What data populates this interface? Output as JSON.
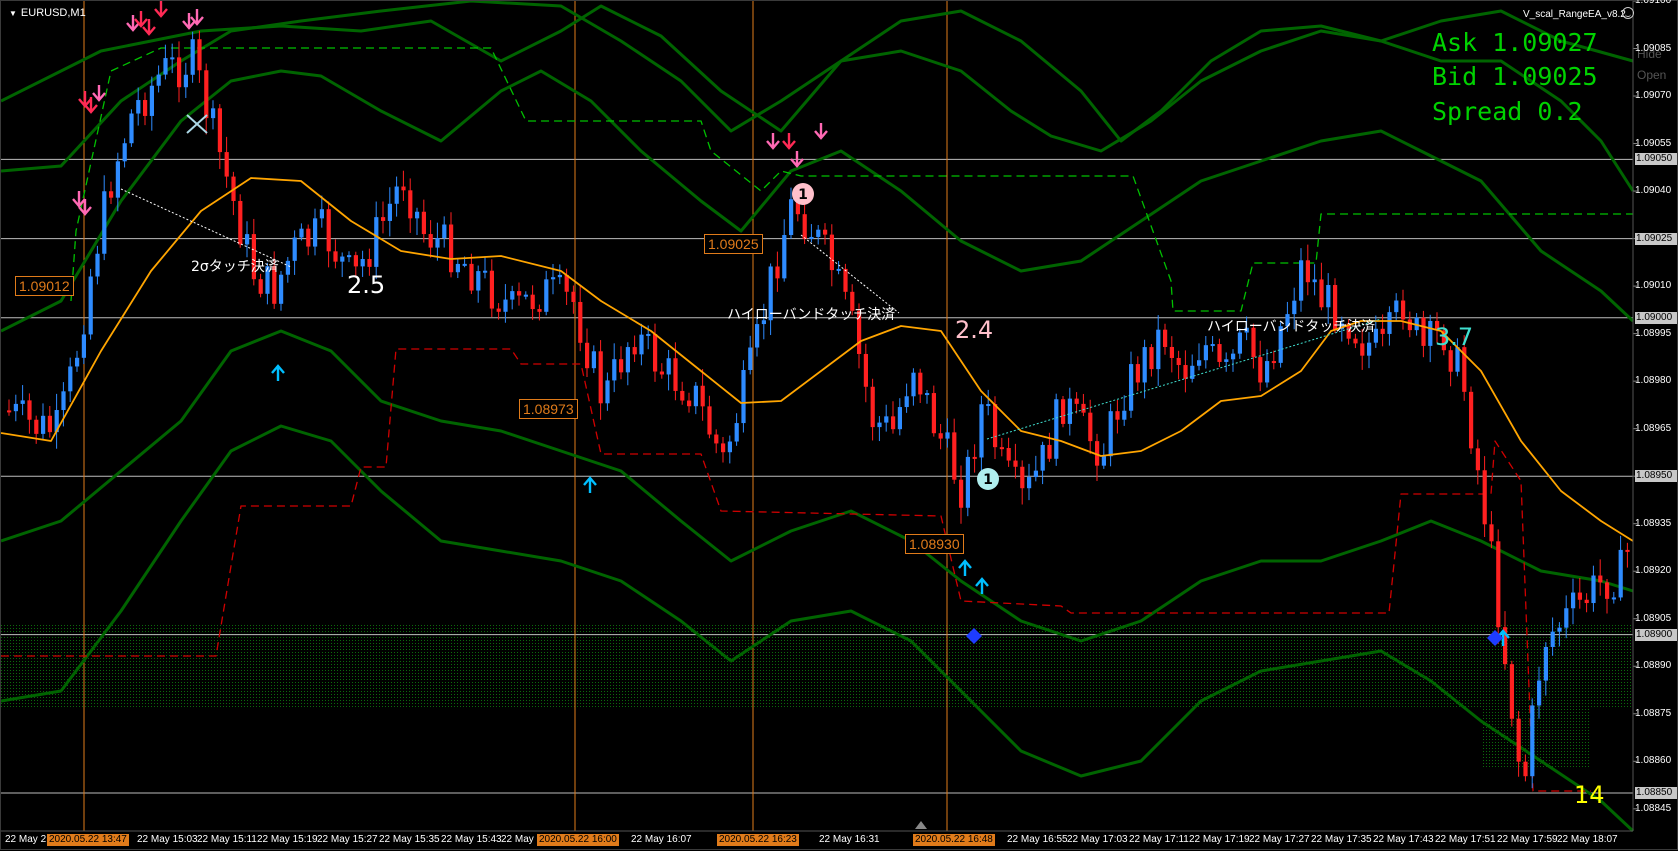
{
  "chart_window": {
    "title": "EURUSD,M1",
    "ea_name": "V_scal_RangeEA_v8.2"
  },
  "hud": {
    "ask": "Ask 1.09027",
    "bid": "Bid 1.09025",
    "spread": "Spread 0.2",
    "color": "#00d200"
  },
  "buttons": {
    "hide": "Hide",
    "open": "Open"
  },
  "price_axis": {
    "ticks": [
      "1.09100",
      "1.09085",
      "1.09070",
      "1.09055",
      "1.09040",
      "1.09025",
      "1.09010",
      "1.08995",
      "1.08980",
      "1.08965",
      "1.08950",
      "1.08935",
      "1.08920",
      "1.08905",
      "1.08890",
      "1.08875",
      "1.08860",
      "1.08845"
    ],
    "highlighted": [
      "1.09050",
      "1.09025",
      "1.09000",
      "1.08950",
      "1.08900",
      "1.08850"
    ]
  },
  "time_axis": {
    "ticks": [
      "22 May 2",
      "22 May 15:03",
      "22 May 15:11",
      "22 May 15:19",
      "22 May 15:27",
      "22 May 15:35",
      "22 May 15:43",
      "22 May 15:51",
      "22 May 16:07",
      "22 May 16:31",
      "22 May 16:55",
      "22 May 17:03",
      "22 May 17:11",
      "22 May 17:19",
      "22 May 17:27",
      "22 May 17:35",
      "22 May 17:43",
      "22 May 17:51",
      "22 May 17:59",
      "22 May 18:07"
    ],
    "markers": [
      "2020.05.22 13:47",
      "2020.05.22 16:00",
      "2020.05.22 16:23",
      "2020.05.22 16:48"
    ]
  },
  "price_labels": [
    "1.09012",
    "1.09025",
    "1.08973",
    "1.08930"
  ],
  "annotations": {
    "touch_close_1": "2σタッチ決済",
    "band_touch_1": "ハイローバンドタッチ決済",
    "band_touch_2": "ハイローバンドタッチ決済",
    "num_25": "2.5",
    "num_24": "2.4",
    "num_37": "3.7",
    "num_14": "14"
  },
  "colors": {
    "bull": "#2e8bff",
    "bear": "#ff2020",
    "ma": "#ffa500",
    "band": "#006400",
    "hi_line": "#00c000",
    "lo_line": "#d00000",
    "session_line": "#e07b1a"
  }
}
